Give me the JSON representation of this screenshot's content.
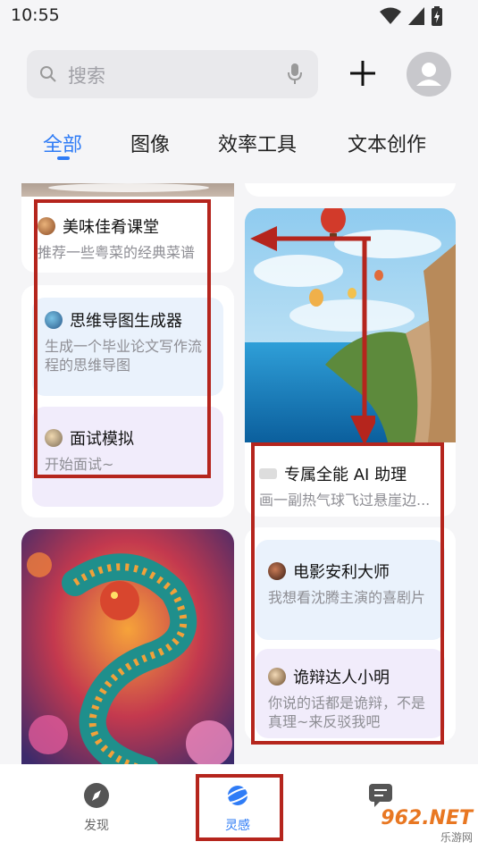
{
  "status": {
    "time": "10:55"
  },
  "search": {
    "placeholder": "搜索"
  },
  "tabs": [
    {
      "label": "全部",
      "active": true
    },
    {
      "label": "图像",
      "active": false
    },
    {
      "label": "效率工具",
      "active": false
    },
    {
      "label": "文本创作",
      "active": false
    }
  ],
  "left_column": {
    "card1": {
      "title": "美味佳肴课堂",
      "subtitle": "推荐一些粤菜的经典菜谱"
    },
    "card2": {
      "title": "思维导图生成器",
      "subtitle": "生成一个毕业论文写作流程的思维导图"
    },
    "card3": {
      "title": "面试模拟",
      "subtitle": "开始面试~"
    }
  },
  "right_column": {
    "image_card": {
      "title": "专属全能 AI 助理",
      "subtitle": "画一副热气球飞过悬崖边..."
    },
    "card2": {
      "title": "电影安利大师",
      "subtitle": "我想看沈腾主演的喜剧片"
    },
    "card3": {
      "title": "诡辩达人小明",
      "subtitle": "你说的话都是诡辩，不是真理~来反驳我吧"
    }
  },
  "bottom_nav": [
    {
      "label": "发现",
      "icon": "compass-icon",
      "active": false
    },
    {
      "label": "灵感",
      "icon": "planet-icon",
      "active": true
    },
    {
      "label": "",
      "icon": "chat-icon",
      "active": false
    }
  ],
  "watermark": {
    "brand": "962.NET",
    "site": "乐游网"
  },
  "colors": {
    "accent": "#2f7cf6",
    "highlight": "#b5251d",
    "blue_panel": "#eaf2fc",
    "purple_panel": "#f1ecfb"
  }
}
